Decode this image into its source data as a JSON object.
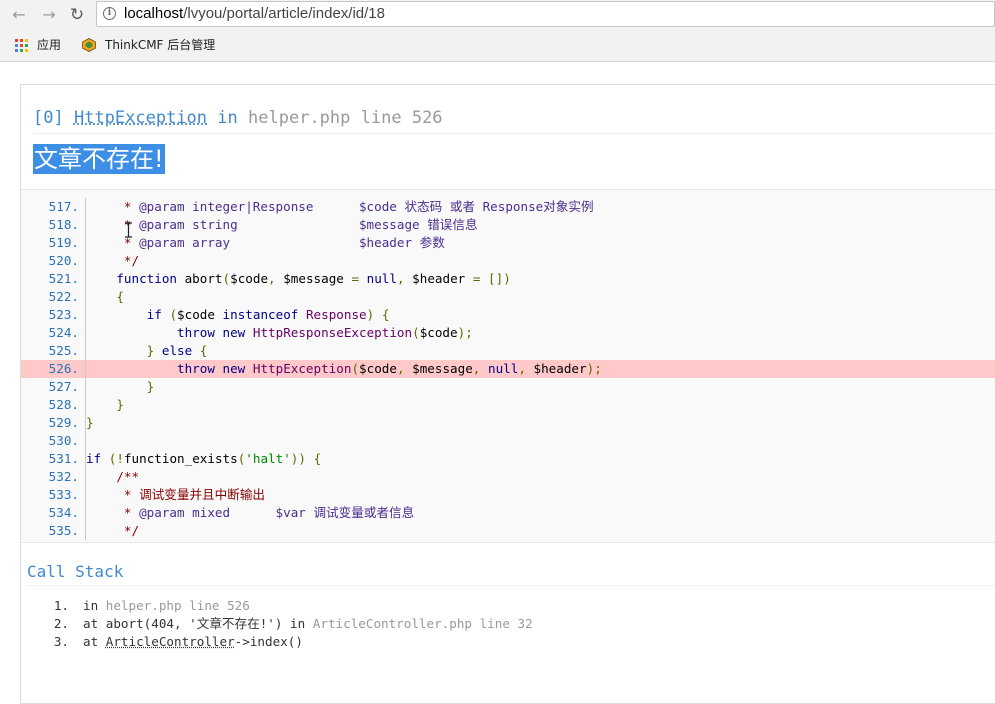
{
  "browser": {
    "url_host": "localhost",
    "url_path": "/lvyou/portal/article/index/id/18",
    "bookmarks": [
      {
        "label": "应用"
      },
      {
        "label": "ThinkCMF 后台管理"
      }
    ]
  },
  "exception": {
    "index": "[0]",
    "class": "HttpException",
    "in_word": "in",
    "file": "helper.php",
    "line_word": "line",
    "line": "526",
    "message": "文章不存在!"
  },
  "source_lines": [
    {
      "num": "517.",
      "code": "     * @param integer|Response      $code 状态码 或者 Response对象实例"
    },
    {
      "num": "518.",
      "code": "     * @param string                $message 错误信息"
    },
    {
      "num": "519.",
      "code": "     * @param array                 $header 参数"
    },
    {
      "num": "520.",
      "code": "     */"
    },
    {
      "num": "521.",
      "code": "    function abort($code, $message = null, $header = [])"
    },
    {
      "num": "522.",
      "code": "    {"
    },
    {
      "num": "523.",
      "code": "        if ($code instanceof Response) {"
    },
    {
      "num": "524.",
      "code": "            throw new HttpResponseException($code);"
    },
    {
      "num": "525.",
      "code": "        } else {"
    },
    {
      "num": "526.",
      "code": "            throw new HttpException($code, $message, null, $header);"
    },
    {
      "num": "527.",
      "code": "        }"
    },
    {
      "num": "528.",
      "code": "    }"
    },
    {
      "num": "529.",
      "code": "}"
    },
    {
      "num": "530.",
      "code": ""
    },
    {
      "num": "531.",
      "code": "if (!function_exists('halt')) {"
    },
    {
      "num": "532.",
      "code": "    /**"
    },
    {
      "num": "533.",
      "code": "     * 调试变量并且中断输出"
    },
    {
      "num": "534.",
      "code": "     * @param mixed      $var 调试变量或者信息"
    },
    {
      "num": "535.",
      "code": "     */"
    }
  ],
  "highlight_line": "526.",
  "call_stack": {
    "title": "Call Stack",
    "items": [
      {
        "num": "1.",
        "pre": "in ",
        "muted": "helper.php line 526",
        "mid": "",
        "abbr": "",
        "post": ""
      },
      {
        "num": "2.",
        "pre": "at abort(404, '文章不存在!') in ",
        "muted": "ArticleController.php line 32",
        "mid": "",
        "abbr": "",
        "post": ""
      },
      {
        "num": "3.",
        "pre": "at ",
        "muted": "",
        "mid": "",
        "abbr": "ArticleController",
        "post": "->index()"
      }
    ]
  },
  "colors": {
    "accent": "#4288ce",
    "selection": "#3d8fe6",
    "highlight_row": "#ffc9c9"
  }
}
